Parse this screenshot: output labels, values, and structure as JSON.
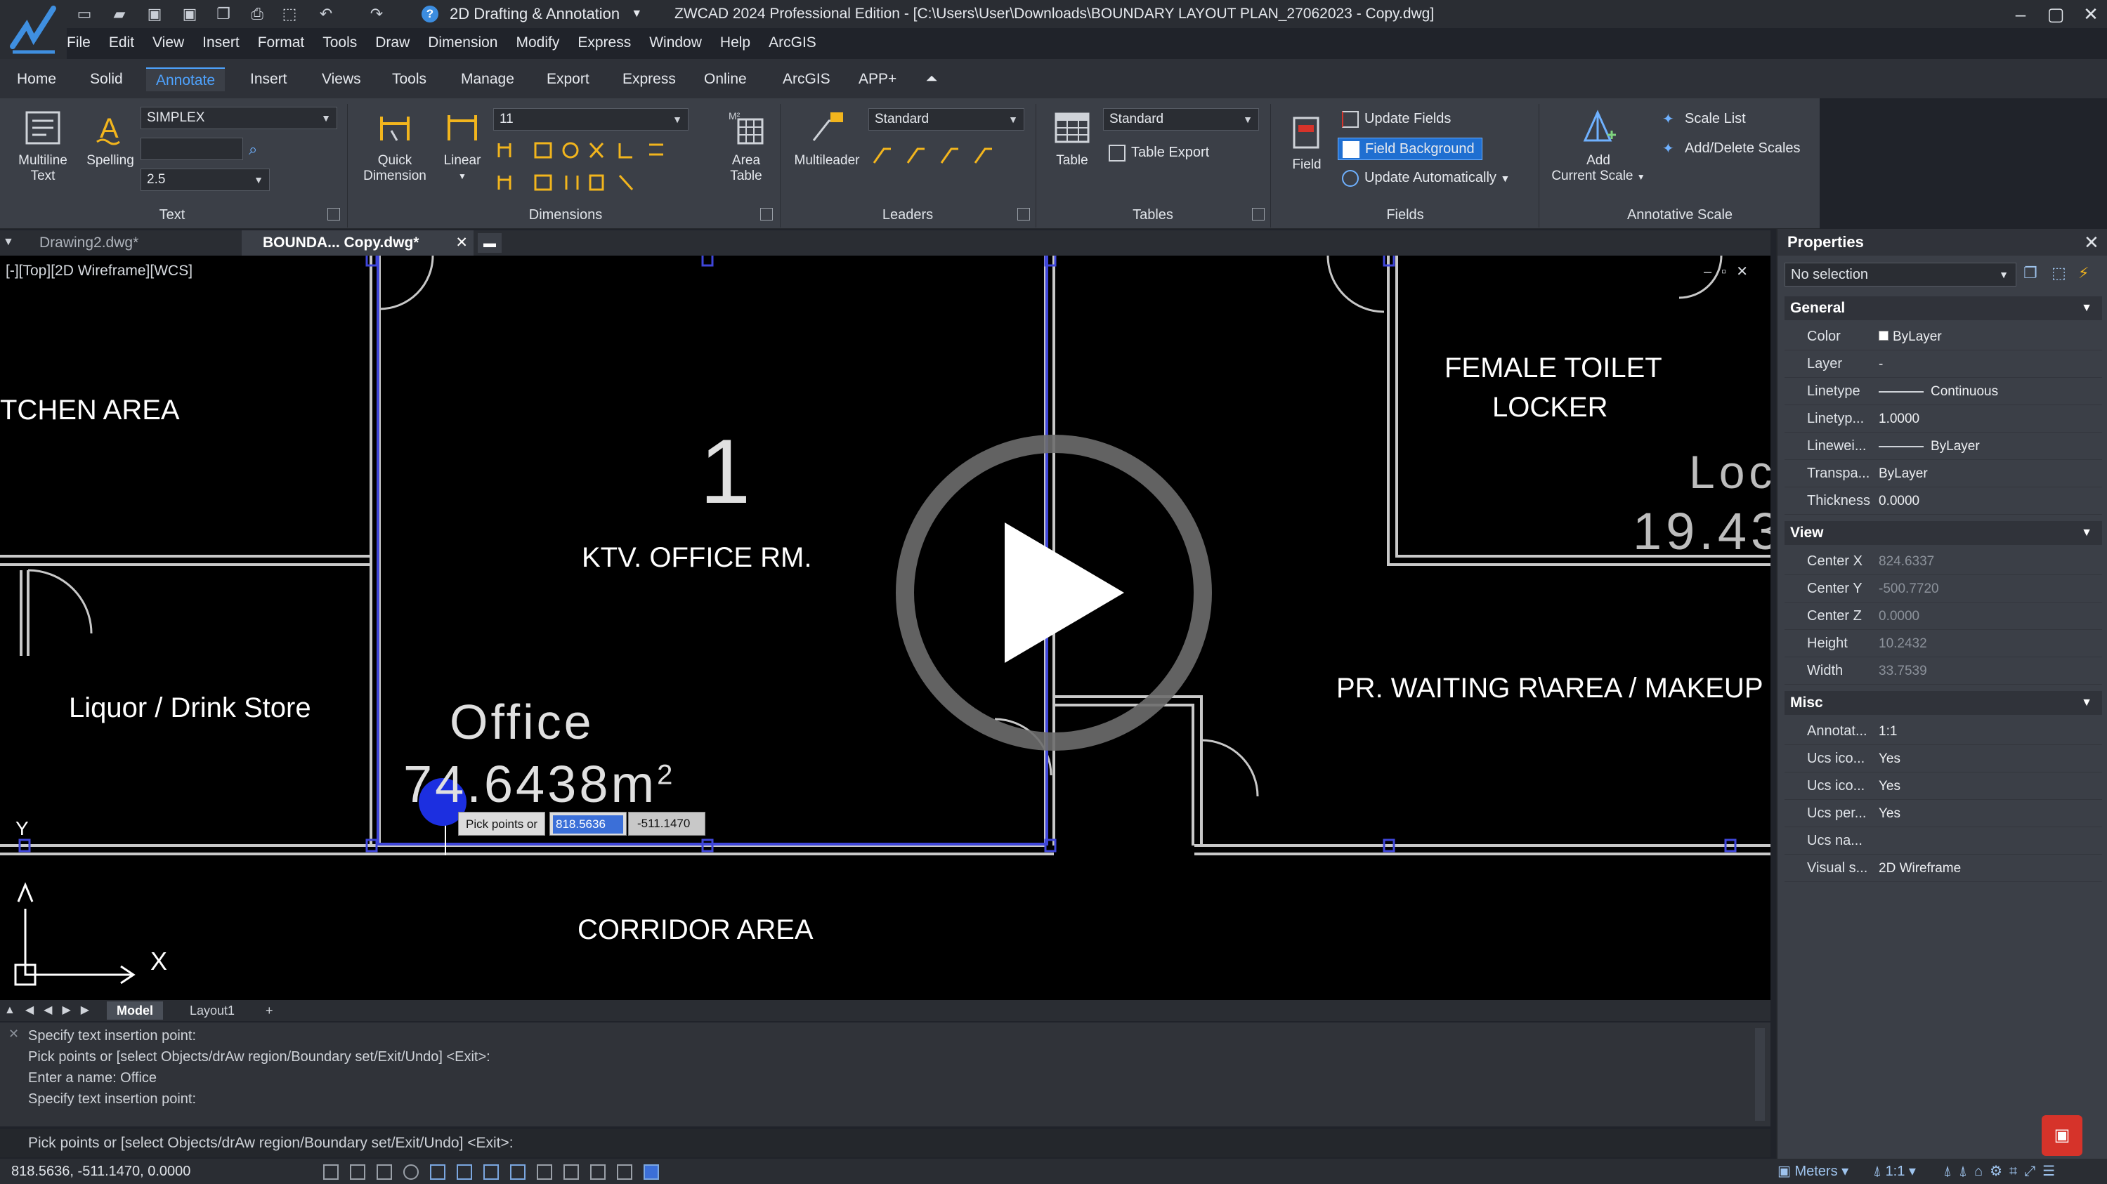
{
  "titlebar": {
    "workspace": "2D Drafting & Annotation",
    "title": "ZWCAD 2024 Professional Edition - [C:\\Users\\User\\Downloads\\BOUNDARY LAYOUT PLAN_27062023 - Copy.dwg]",
    "help_glyph": "?"
  },
  "menu": [
    "File",
    "Edit",
    "View",
    "Insert",
    "Format",
    "Tools",
    "Draw",
    "Dimension",
    "Modify",
    "Express",
    "Window",
    "Help",
    "ArcGIS"
  ],
  "ribbon_tabs": [
    "Home",
    "Solid",
    "Annotate",
    "Insert",
    "Views",
    "Tools",
    "Manage",
    "Export",
    "Express",
    "Online",
    "ArcGIS",
    "APP+"
  ],
  "ribbon": {
    "text": {
      "title": "Text",
      "multiline": "Multiline",
      "multiline2": "Text",
      "spelling": "Spelling",
      "font": "SIMPLEX",
      "height": "2.5"
    },
    "dimensions": {
      "title": "Dimensions",
      "quick": "Quick",
      "quick2": "Dimension",
      "linear": "Linear",
      "style": "11",
      "area": "Area",
      "area2": "Table"
    },
    "leaders": {
      "title": "Leaders",
      "multileader": "Multileader",
      "style": "Standard"
    },
    "tables": {
      "title": "Tables",
      "table": "Table",
      "style": "Standard",
      "export": "Table Export"
    },
    "fields": {
      "title": "Fields",
      "field": "Field",
      "update": "Update Fields",
      "background": "Field Background",
      "auto": "Update Automatically"
    },
    "scale": {
      "title": "Annotative Scale",
      "add": "Add",
      "add2": "Current Scale",
      "list": "Scale List",
      "adddel": "Add/Delete Scales"
    }
  },
  "doc_tabs": [
    "Drawing2.dwg*",
    "BOUNDA... Copy.dwg*"
  ],
  "viewport": {
    "label": "[-][Top][2D Wireframe][WCS]",
    "rooms": {
      "kitchen": "TCHEN AREA",
      "ktv": "KTV. OFFICE RM.",
      "num": "1",
      "liquor": "Liquor / Drink Store",
      "office": "Office",
      "area_val": "74.6438m",
      "area_sup": "2",
      "female1": "FEMALE TOILET",
      "female2": "LOCKER",
      "loc1": "Loc",
      "loc2": "19.43",
      "waiting": "PR. WAITING R\\AREA / MAKEUP",
      "corridor": "CORRIDOR AREA"
    },
    "tooltip": "Pick points or",
    "in_x": "818.5636",
    "in_y": "-511.1470",
    "axis_x": "X",
    "axis_y": "Y"
  },
  "layout_tabs": [
    "Model",
    "Layout1",
    "+"
  ],
  "command_history": [
    "Specify text insertion point:",
    "Pick points or [select Objects/drAw region/Boundary set/Exit/Undo] <Exit>:",
    "Enter a name: Office",
    "Specify text insertion point:"
  ],
  "command_line": "Pick points or [select Objects/drAw region/Boundary set/Exit/Undo] <Exit>:",
  "status": {
    "coords": "818.5636, -511.1470, 0.0000",
    "units": "Meters",
    "scale": "1:1"
  },
  "properties": {
    "title": "Properties",
    "selection": "No selection",
    "general": {
      "title": "General",
      "rows": [
        {
          "k": "Color",
          "v": "ByLayer"
        },
        {
          "k": "Layer",
          "v": "-"
        },
        {
          "k": "Linetype",
          "v": "Continuous"
        },
        {
          "k": "Linetyp...",
          "v": "1.0000"
        },
        {
          "k": "Linewei...",
          "v": "ByLayer"
        },
        {
          "k": "Transpa...",
          "v": "ByLayer"
        },
        {
          "k": "Thickness",
          "v": "0.0000"
        }
      ]
    },
    "view": {
      "title": "View",
      "rows": [
        {
          "k": "Center X",
          "v": "824.6337"
        },
        {
          "k": "Center Y",
          "v": "-500.7720"
        },
        {
          "k": "Center Z",
          "v": "0.0000"
        },
        {
          "k": "Height",
          "v": "10.2432"
        },
        {
          "k": "Width",
          "v": "33.7539"
        }
      ]
    },
    "misc": {
      "title": "Misc",
      "rows": [
        {
          "k": "Annotat...",
          "v": "1:1"
        },
        {
          "k": "Ucs ico...",
          "v": "Yes"
        },
        {
          "k": "Ucs ico...",
          "v": "Yes"
        },
        {
          "k": "Ucs per...",
          "v": "Yes"
        },
        {
          "k": "Ucs na...",
          "v": ""
        },
        {
          "k": "Visual s...",
          "v": "2D Wireframe"
        }
      ]
    }
  },
  "colors": {
    "accent": "#4ea3ff",
    "field_bg": "#1f6fd1",
    "wall": "#c8c8c8",
    "boundary": "#3f46d9"
  }
}
